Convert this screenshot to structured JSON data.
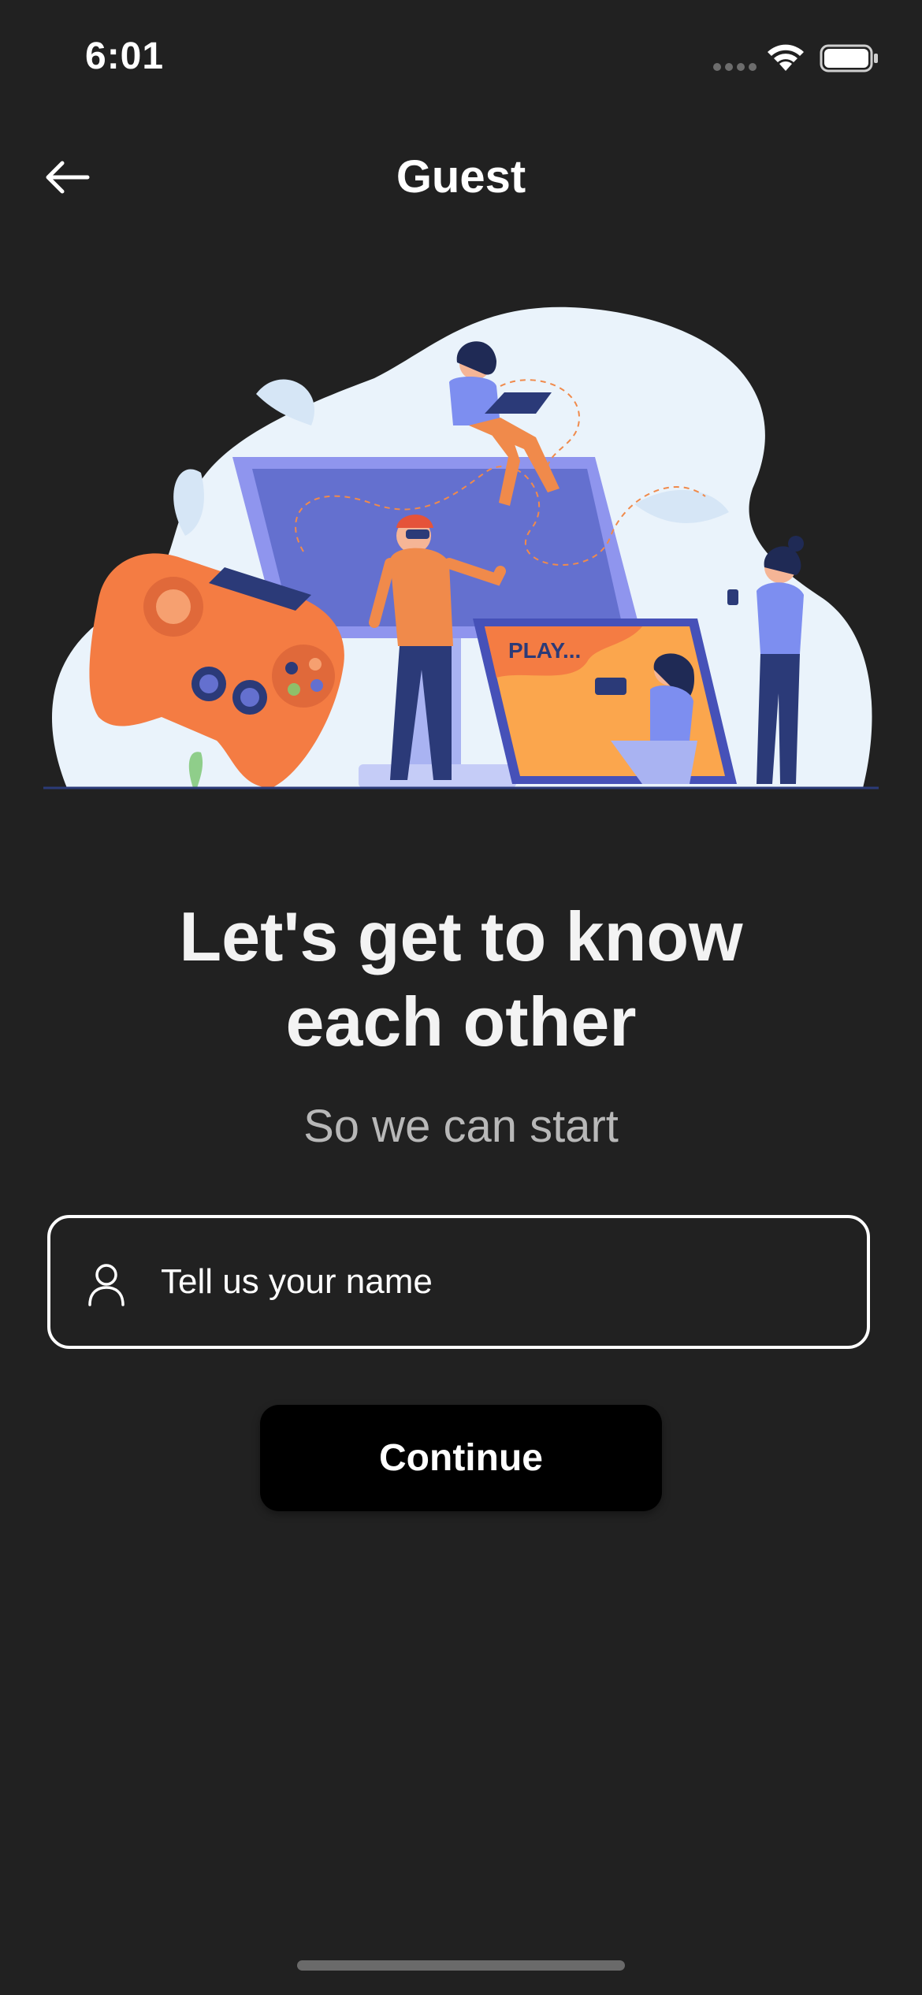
{
  "status_bar": {
    "time": "6:01"
  },
  "nav": {
    "back_icon": "arrow-left-icon",
    "title": "Guest"
  },
  "illustration": {
    "screen_text": "PLAY...",
    "colors": {
      "blob": "#eaf3fb",
      "monitor": "#7b82e0",
      "accent_orange": "#f08a4b",
      "navy": "#2b3a78"
    }
  },
  "main": {
    "headline_line1": "Let's get to know",
    "headline_line2": "each other",
    "subhead": "So we can start"
  },
  "form": {
    "name_placeholder": "Tell us your name",
    "name_value": "",
    "name_icon": "user-icon",
    "continue_label": "Continue"
  },
  "theme": {
    "background": "#212121",
    "button_bg": "#000000",
    "text": "#ffffff",
    "muted_text": "#b8b8b8"
  }
}
